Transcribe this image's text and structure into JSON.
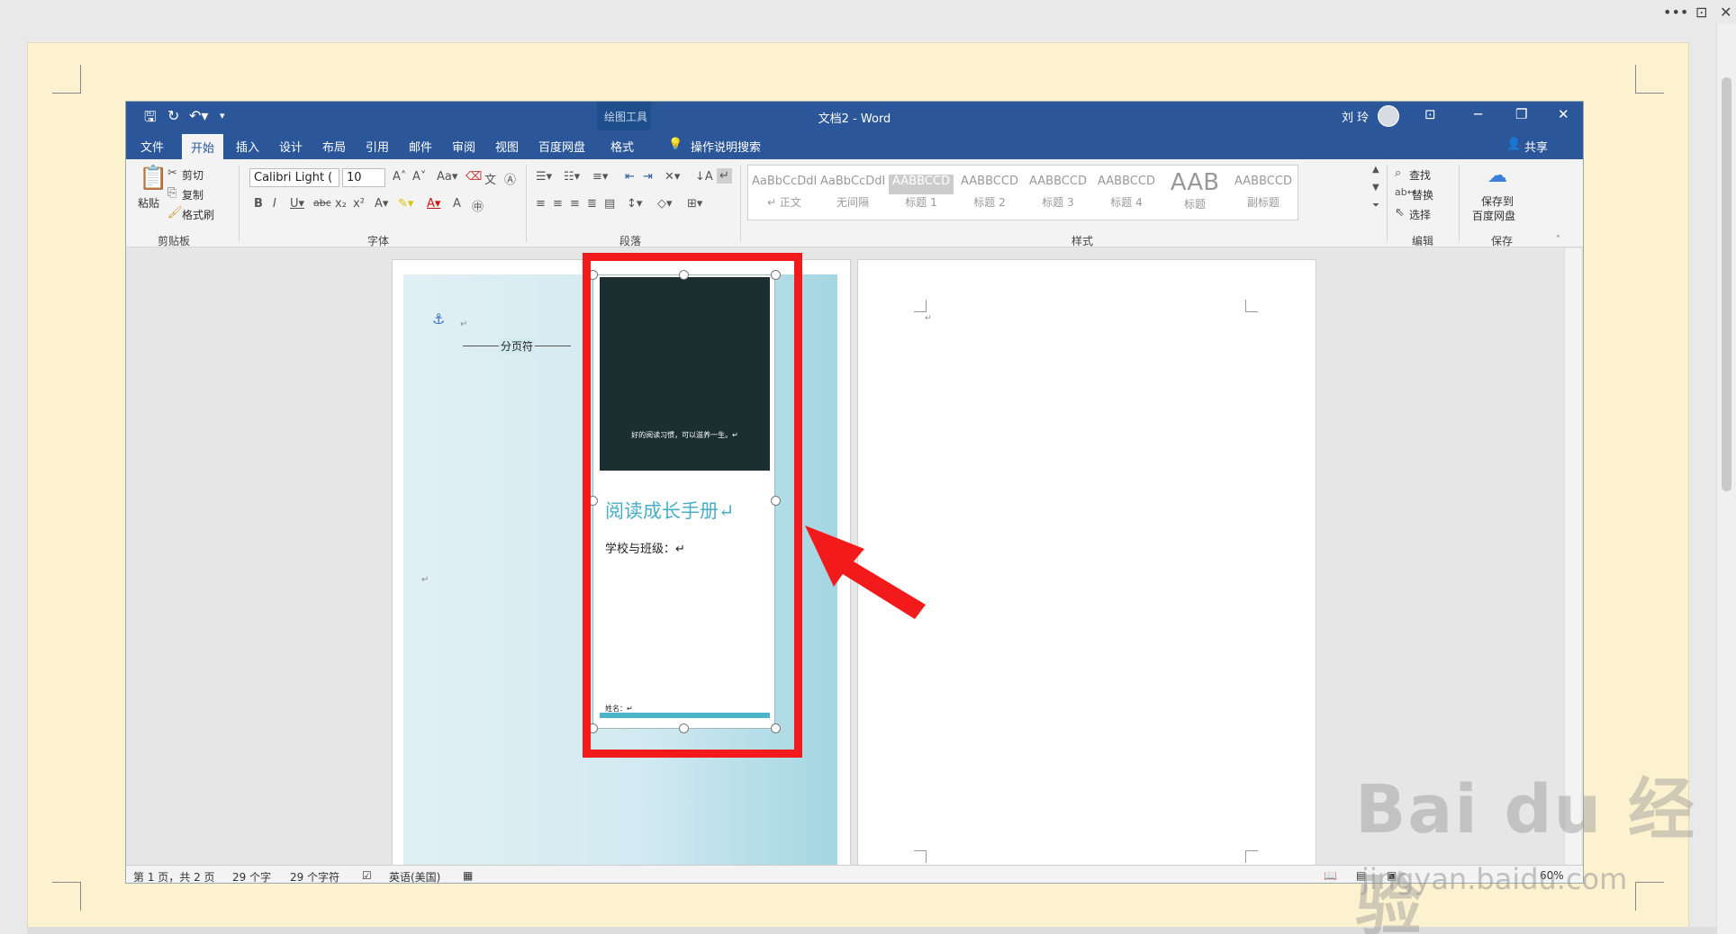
{
  "outer": {
    "more_icon": "•••",
    "restore_icon": "⊡",
    "close_icon": "✕"
  },
  "titlebar": {
    "context_group": "绘图工具",
    "document_title": "文档2  -  Word",
    "user_name": "刘 玲",
    "minimize": "─",
    "restore": "❐",
    "close": "✕",
    "ribbon_display": "⊡"
  },
  "tabs": [
    "文件",
    "开始",
    "插入",
    "设计",
    "布局",
    "引用",
    "邮件",
    "审阅",
    "视图",
    "百度网盘",
    "格式"
  ],
  "active_tab": "开始",
  "tell_me": "操作说明搜索",
  "share": "共享",
  "ribbon": {
    "clipboard": {
      "paste": "粘贴",
      "cut": "剪切",
      "copy": "复制",
      "format_painter": "格式刷",
      "label": "剪贴板"
    },
    "font": {
      "font_name": "Calibri Light (",
      "font_size": "10",
      "label": "字体"
    },
    "paragraph": {
      "label": "段落"
    },
    "styles": {
      "label": "样式",
      "items": [
        {
          "preview": "AaBbCcDdI",
          "name": "↵ 正文"
        },
        {
          "preview": "AaBbCcDdI",
          "name": "无间隔"
        },
        {
          "preview": "AABBCCD",
          "name": "标题 1"
        },
        {
          "preview": "AABBCCD",
          "name": "标题 2"
        },
        {
          "preview": "AABBCCD",
          "name": "标题 3"
        },
        {
          "preview": "AABBCCD",
          "name": "标题 4"
        },
        {
          "preview": "AAB",
          "name": "标题"
        },
        {
          "preview": "AABBCCD",
          "name": "副标题"
        }
      ]
    },
    "editing": {
      "find": "查找",
      "replace": "替换",
      "select": "选择",
      "label": "编辑"
    },
    "save": {
      "save_to": "保存到",
      "baidu": "百度网盘",
      "label": "保存"
    }
  },
  "document": {
    "page_break": "分页符",
    "slogan": "好的阅读习惯，可以滋养一生。↵",
    "title": "阅读成长手册↵",
    "school_class": "学校与班级：↵",
    "name_label": "姓名：↵",
    "para_mark": "↵"
  },
  "status": {
    "page": "第 1 页，共 2 页",
    "words": "29 个字",
    "chars": "29 个字符",
    "language": "英语(美国)",
    "zoom": "60%"
  },
  "watermark": {
    "text": "Bai du 经验",
    "url": "jingyan.baidu.com"
  }
}
